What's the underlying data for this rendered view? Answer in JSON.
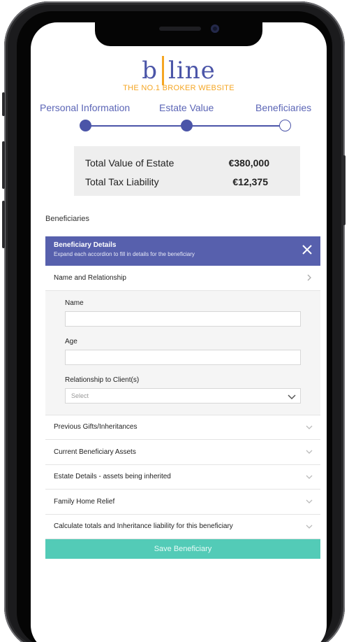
{
  "logo": {
    "left": "b",
    "right": "line",
    "tagline": "THE NO.1 BROKER WEBSITE"
  },
  "steps": [
    "Personal Information",
    "Estate Value",
    "Beneficiaries"
  ],
  "totals": [
    {
      "label": "Total Value of Estate",
      "value": "€380,000"
    },
    {
      "label": "Total Tax Liability",
      "value": "€12,375"
    }
  ],
  "section_title": "Beneficiaries",
  "accordion": {
    "header_title": "Beneficiary Details",
    "header_subtitle": "Expand each accordion to fill in details for the beneficiary",
    "expanded_item": "Name and Relationship",
    "fields": {
      "name_label": "Name",
      "age_label": "Age",
      "relationship_label": "Relationship to Client(s)",
      "relationship_value": "Select"
    },
    "collapsed_items": [
      "Previous Gifts/Inheritances",
      "Current Beneficiary Assets",
      "Estate Details - assets being inherited",
      "Family Home Relief",
      "Calculate totals and Inheritance liability for this beneficiary"
    ]
  },
  "save_button": "Save Beneficiary",
  "colors": {
    "brand": "#4b55a8",
    "accent": "#f5a623",
    "header": "#5760ad",
    "save": "#53cbb7"
  }
}
